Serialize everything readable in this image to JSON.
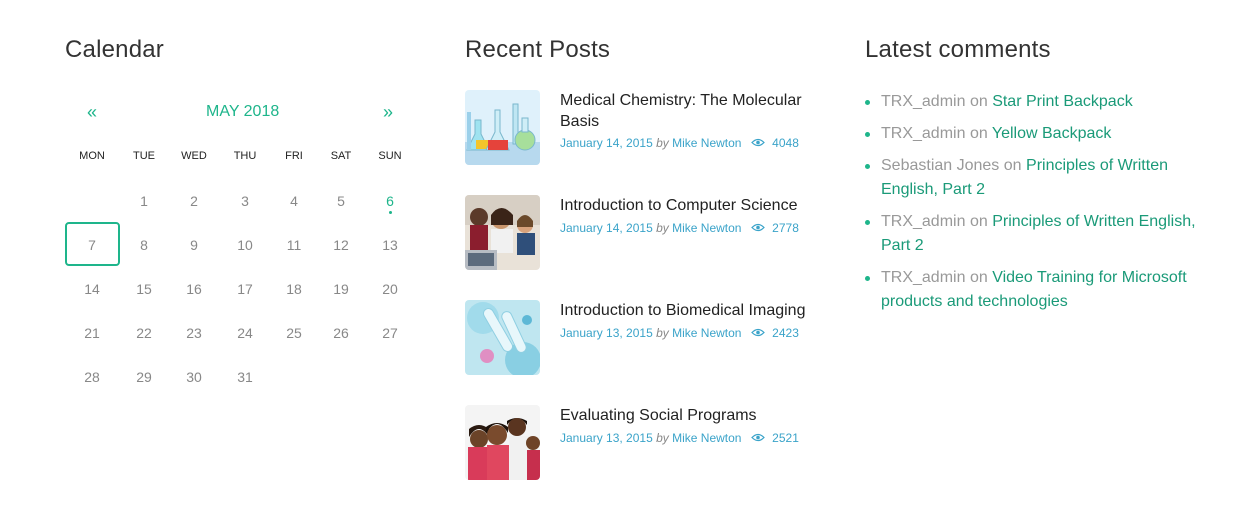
{
  "calendar": {
    "title": "Calendar",
    "prev_label": "«",
    "next_label": "»",
    "month_label": "MAY 2018",
    "weekdays": [
      "MON",
      "TUE",
      "WED",
      "THU",
      "FRI",
      "SAT",
      "SUN"
    ],
    "weeks": [
      [
        "",
        "1",
        "2",
        "3",
        "4",
        "5",
        "6"
      ],
      [
        "7",
        "8",
        "9",
        "10",
        "11",
        "12",
        "13"
      ],
      [
        "14",
        "15",
        "16",
        "17",
        "18",
        "19",
        "20"
      ],
      [
        "21",
        "22",
        "23",
        "24",
        "25",
        "26",
        "27"
      ],
      [
        "28",
        "29",
        "30",
        "31",
        "",
        "",
        ""
      ]
    ],
    "today": "7",
    "days_with_posts": [
      "6"
    ]
  },
  "recent_posts": {
    "title": "Recent Posts",
    "by_label": "by",
    "posts": [
      {
        "title": "Medical Chemistry: The Molecular Basis",
        "date": "January 14, 2015",
        "author": "Mike Newton",
        "views": "4048",
        "thumb_icon": "lab-glassware-thumbnail"
      },
      {
        "title": "Introduction to Computer Science",
        "date": "January 14, 2015",
        "author": "Mike Newton",
        "views": "2778",
        "thumb_icon": "students-computer-thumbnail"
      },
      {
        "title": "Introduction to Biomedical Imaging",
        "date": "January 13, 2015",
        "author": "Mike Newton",
        "views": "2423",
        "thumb_icon": "test-tubes-thumbnail"
      },
      {
        "title": "Evaluating Social Programs",
        "date": "January 13, 2015",
        "author": "Mike Newton",
        "views": "2521",
        "thumb_icon": "children-group-thumbnail"
      }
    ]
  },
  "latest_comments": {
    "title": "Latest comments",
    "on_label": "on",
    "items": [
      {
        "author": "TRX_admin",
        "post": "Star Print Backpack"
      },
      {
        "author": "TRX_admin",
        "post": "Yellow Backpack"
      },
      {
        "author": "Sebastian Jones",
        "post": "Principles of Written English, Part 2"
      },
      {
        "author": "TRX_admin",
        "post": "Principles of Written English, Part 2"
      },
      {
        "author": "TRX_admin",
        "post": "Video Training for Microsoft products and technologies"
      }
    ]
  },
  "colors": {
    "accent": "#1eb58b",
    "meta_blue": "#3aa3c9",
    "muted": "#999999",
    "title": "#333333"
  }
}
